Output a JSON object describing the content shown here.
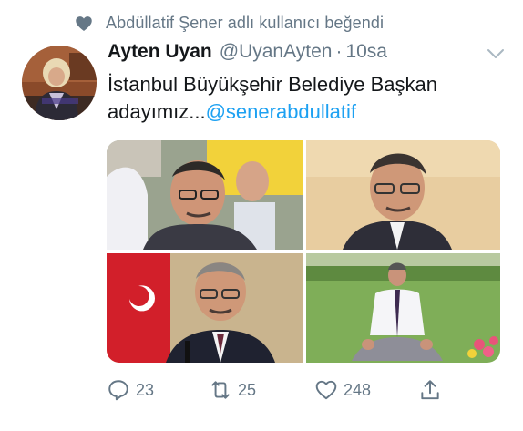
{
  "context": {
    "text": "Abdüllatif Şener adlı kullanıcı beğendi",
    "icon": "heart-icon"
  },
  "author": {
    "display_name": "Ayten Uyan",
    "handle": "@UyanAyten",
    "separator": "·",
    "time": "10sa"
  },
  "tweet": {
    "text": "İstanbul Büyükşehir Belediye Başkan adayımız...",
    "mention": "@senerabdullatif"
  },
  "media": {
    "count": 4,
    "photos": [
      "photo-1",
      "photo-2",
      "photo-3",
      "photo-4"
    ]
  },
  "actions": {
    "reply_count": "23",
    "retweet_count": "25",
    "like_count": "248",
    "icons": [
      "reply-icon",
      "retweet-icon",
      "like-icon",
      "share-icon"
    ]
  },
  "colors": {
    "accent": "#1da1f2",
    "secondary_text": "#657786",
    "primary_text": "#14171a"
  }
}
